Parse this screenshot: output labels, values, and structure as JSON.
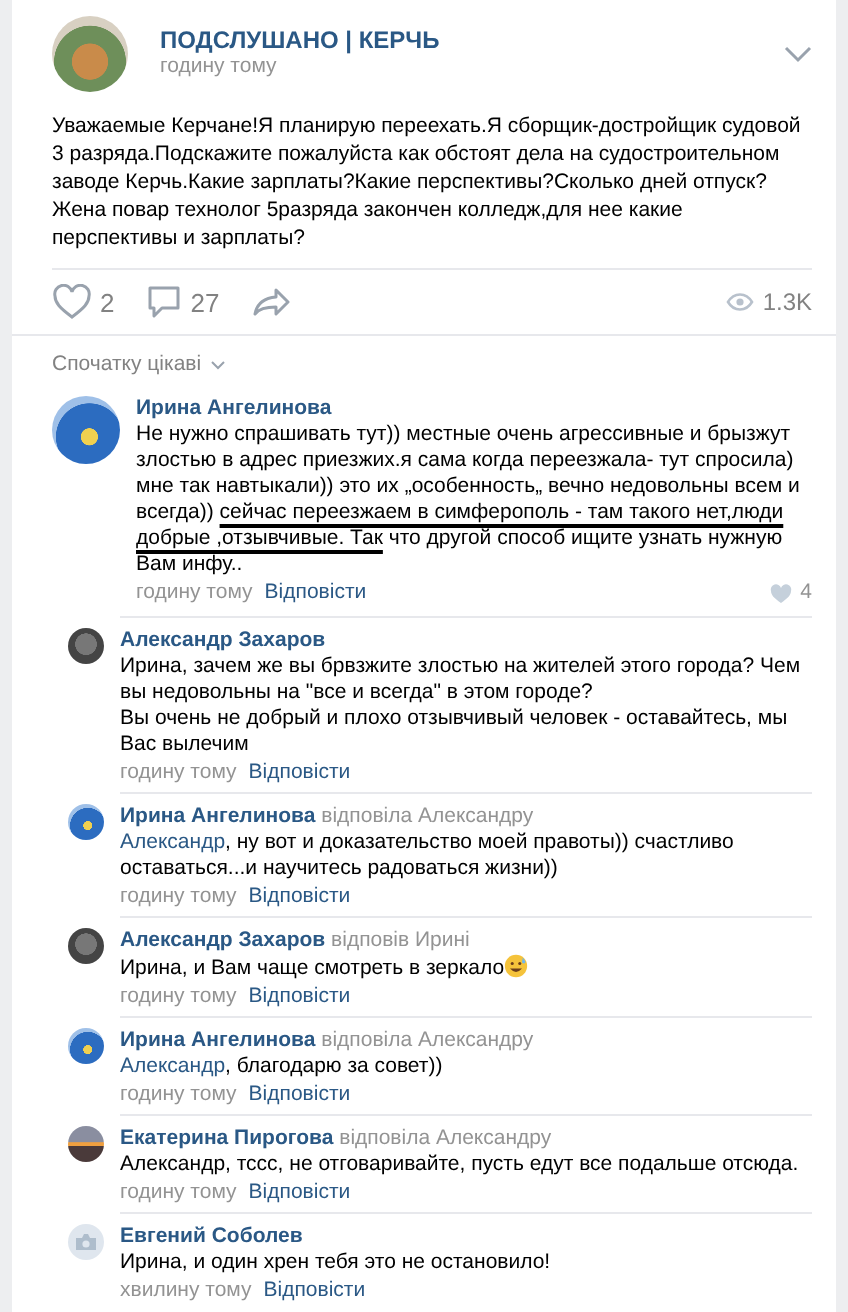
{
  "post": {
    "author": "ПОДСЛУШАНО | КЕРЧЬ",
    "time": "годину тому",
    "text": "Уважаемые Керчане!Я планирую переехать.Я сборщик-достройщик судовой 3 разряда.Подскажите пожалуйста как обстоят дела на судостроительном заводе Керчь.Какие зарплаты?Какие перспективы?Сколько дней отпуск?\nЖена повар технолог 5разряда закончен колледж,для нее какие перспективы и зарплаты?",
    "likes": "2",
    "comments": "27",
    "views": "1.3K"
  },
  "sort": {
    "label": "Спочатку цікаві"
  },
  "comments": [
    {
      "author": "Ирина Ангелинова",
      "has_photo": true,
      "segments": [
        {
          "text": "Не нужно спрашивать тут)) местные очень агрессивные и брызжут злостью в адрес приезжих.я сама когда переезжала- тут спросила) мне так навтыкали)) это их „особенность„ вечно недовольны всем и всегда)) ",
          "underlined": false
        },
        {
          "text": "сейчас переезжаем в симферополь - там такого нет,люди добрые ,отзывчивые. Так",
          "underlined": true
        },
        {
          "text": " что другой способ ищите узнать нужную Вам инфу..",
          "underlined": false
        }
      ],
      "time": "годину тому",
      "reply": "Відповісти",
      "likes": "4",
      "replies": [
        {
          "author": "Александр Захаров",
          "has_photo": true,
          "text": "Ирина, зачем же вы брвзжите злостью на жителей этого города? Чем вы недовольны на \"все и всегда\" в этом городе?\nВы очень не добрый и плохо отзывчивый человек - оставайтесь, мы Вас вылечим",
          "time": "годину тому",
          "reply": "Відповісти"
        },
        {
          "author": "Ирина Ангелинова",
          "has_photo": true,
          "to": "відповіла Александру",
          "mention": "Александр",
          "text": ", ну вот и доказательство моей правоты)) счастливо оставаться...и научитесь радоваться жизни))",
          "time": "годину тому",
          "reply": "Відповісти"
        },
        {
          "author": "Александр Захаров",
          "has_photo": true,
          "to": "відповів Ирині",
          "text": "Ирина, и Вам чаще смотреть в зеркало",
          "emoji": true,
          "time": "годину тому",
          "reply": "Відповісти"
        },
        {
          "author": "Ирина Ангелинова",
          "has_photo": true,
          "to": "відповіла Александру",
          "mention": "Александр",
          "text": ", благодарю за совет))",
          "time": "годину тому",
          "reply": "Відповісти"
        },
        {
          "author": "Екатерина Пирогова",
          "has_photo": true,
          "to": "відповіла Александру",
          "text": "Александр, тссс, не отговаривайте, пусть едут все подальше отсюда.",
          "time": "годину тому",
          "reply": "Відповісти"
        },
        {
          "author": "Евгений Соболев",
          "has_photo": false,
          "text": "Ирина, и один хрен тебя это не остановило!",
          "time": "хвилину тому",
          "reply": "Відповісти"
        }
      ]
    }
  ]
}
